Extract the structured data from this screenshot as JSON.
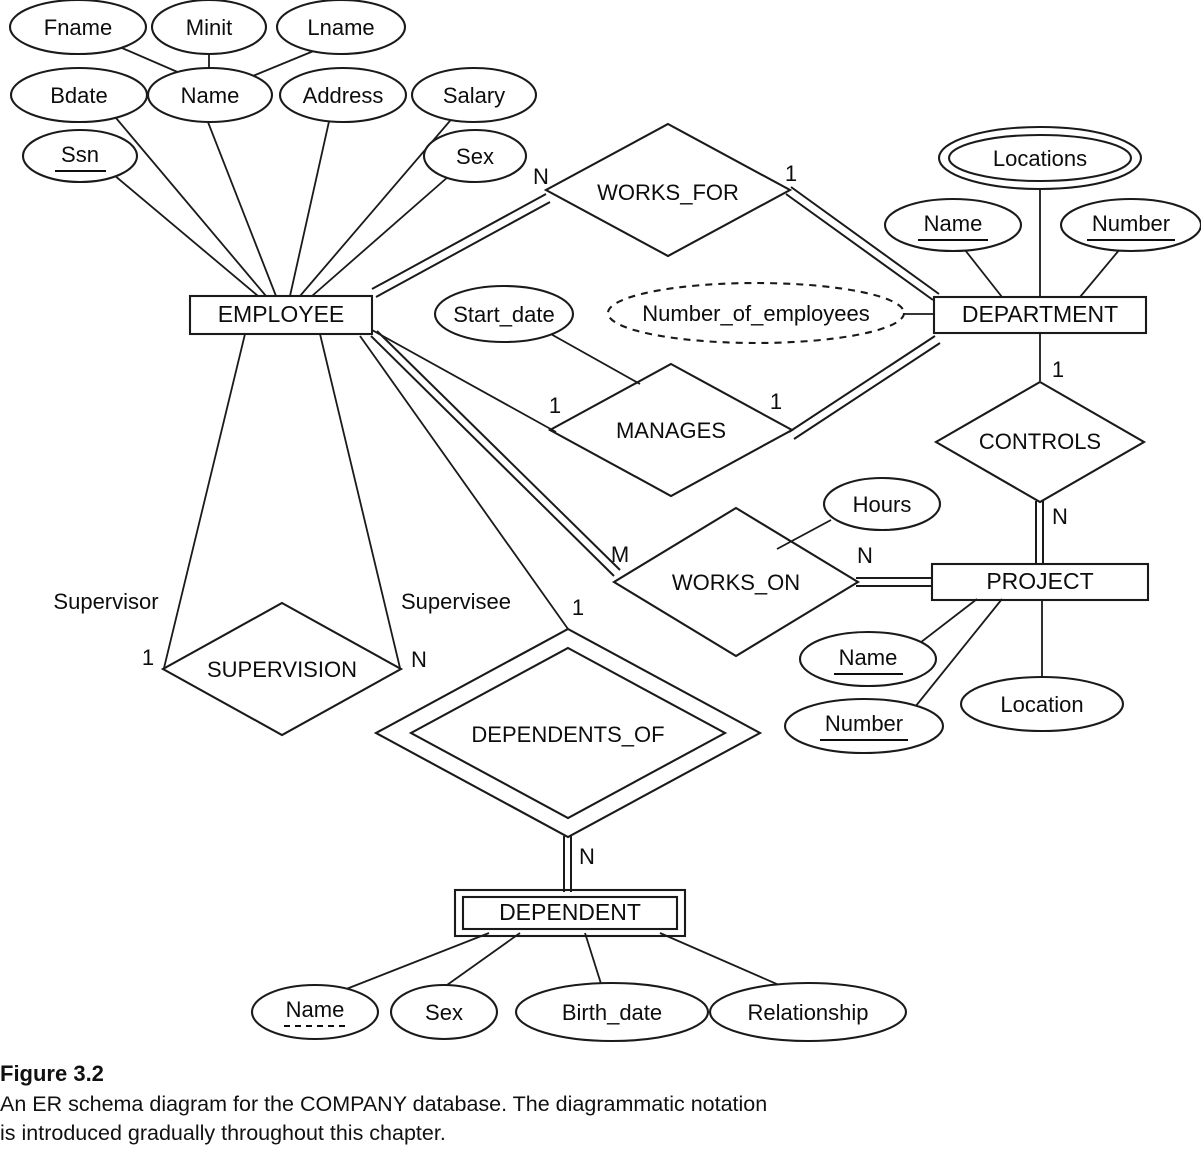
{
  "figure": {
    "title": "Figure 3.2",
    "caption": "An ER schema diagram for the COMPANY database. The diagrammatic notation\nis introduced gradually throughout this chapter."
  },
  "colors": {
    "shape_fill": "#e8e8e8",
    "shape_stroke": "#1a1a1a",
    "ellipse_fill": "#ffffff",
    "background": "#ffffff",
    "text": "#0d0d0d"
  },
  "entities": {
    "employee": {
      "label": "EMPLOYEE",
      "type": "strong"
    },
    "department": {
      "label": "DEPARTMENT",
      "type": "strong"
    },
    "project": {
      "label": "PROJECT",
      "type": "strong"
    },
    "dependent": {
      "label": "DEPENDENT",
      "type": "weak"
    }
  },
  "relationships": {
    "works_for": {
      "label": "WORKS_FOR",
      "type": "regular"
    },
    "manages": {
      "label": "MANAGES",
      "type": "regular"
    },
    "works_on": {
      "label": "WORKS_ON",
      "type": "regular"
    },
    "supervision": {
      "label": "SUPERVISION",
      "type": "regular"
    },
    "controls": {
      "label": "CONTROLS",
      "type": "regular"
    },
    "dependents_of": {
      "label": "DEPENDENTS_OF",
      "type": "identifying"
    }
  },
  "attributes": {
    "employee": {
      "fname": {
        "label": "Fname",
        "type": "simple"
      },
      "minit": {
        "label": "Minit",
        "type": "simple"
      },
      "lname": {
        "label": "Lname",
        "type": "simple"
      },
      "name": {
        "label": "Name",
        "type": "composite"
      },
      "bdate": {
        "label": "Bdate",
        "type": "simple"
      },
      "address": {
        "label": "Address",
        "type": "simple"
      },
      "salary": {
        "label": "Salary",
        "type": "simple"
      },
      "ssn": {
        "label": "Ssn",
        "type": "key"
      },
      "sex": {
        "label": "Sex",
        "type": "simple"
      }
    },
    "department": {
      "locations": {
        "label": "Locations",
        "type": "multivalued"
      },
      "name": {
        "label": "Name",
        "type": "key"
      },
      "number": {
        "label": "Number",
        "type": "key"
      },
      "number_of_employees": {
        "label": "Number_of_employees",
        "type": "derived"
      }
    },
    "project": {
      "name": {
        "label": "Name",
        "type": "key"
      },
      "number": {
        "label": "Number",
        "type": "key"
      },
      "location": {
        "label": "Location",
        "type": "simple"
      }
    },
    "dependent": {
      "name": {
        "label": "Name",
        "type": "partial-key"
      },
      "sex": {
        "label": "Sex",
        "type": "simple"
      },
      "birth_date": {
        "label": "Birth_date",
        "type": "simple"
      },
      "relationship": {
        "label": "Relationship",
        "type": "simple"
      }
    },
    "relationship_attributes": {
      "start_date": {
        "label": "Start_date",
        "type": "simple",
        "on": "MANAGES"
      },
      "hours": {
        "label": "Hours",
        "type": "simple",
        "on": "WORKS_ON"
      }
    }
  },
  "cardinalities": {
    "works_for_employee": "N",
    "works_for_department": "1",
    "manages_employee": "1",
    "manages_department": "1",
    "controls_department": "1",
    "controls_project": "N",
    "works_on_employee": "M",
    "works_on_project": "N",
    "supervision_supervisor": "1",
    "supervision_supervisee": "N",
    "dependents_of_employee": "1",
    "dependents_of_dependent": "N"
  },
  "roles": {
    "supervisor": "Supervisor",
    "supervisee": "Supervisee"
  }
}
